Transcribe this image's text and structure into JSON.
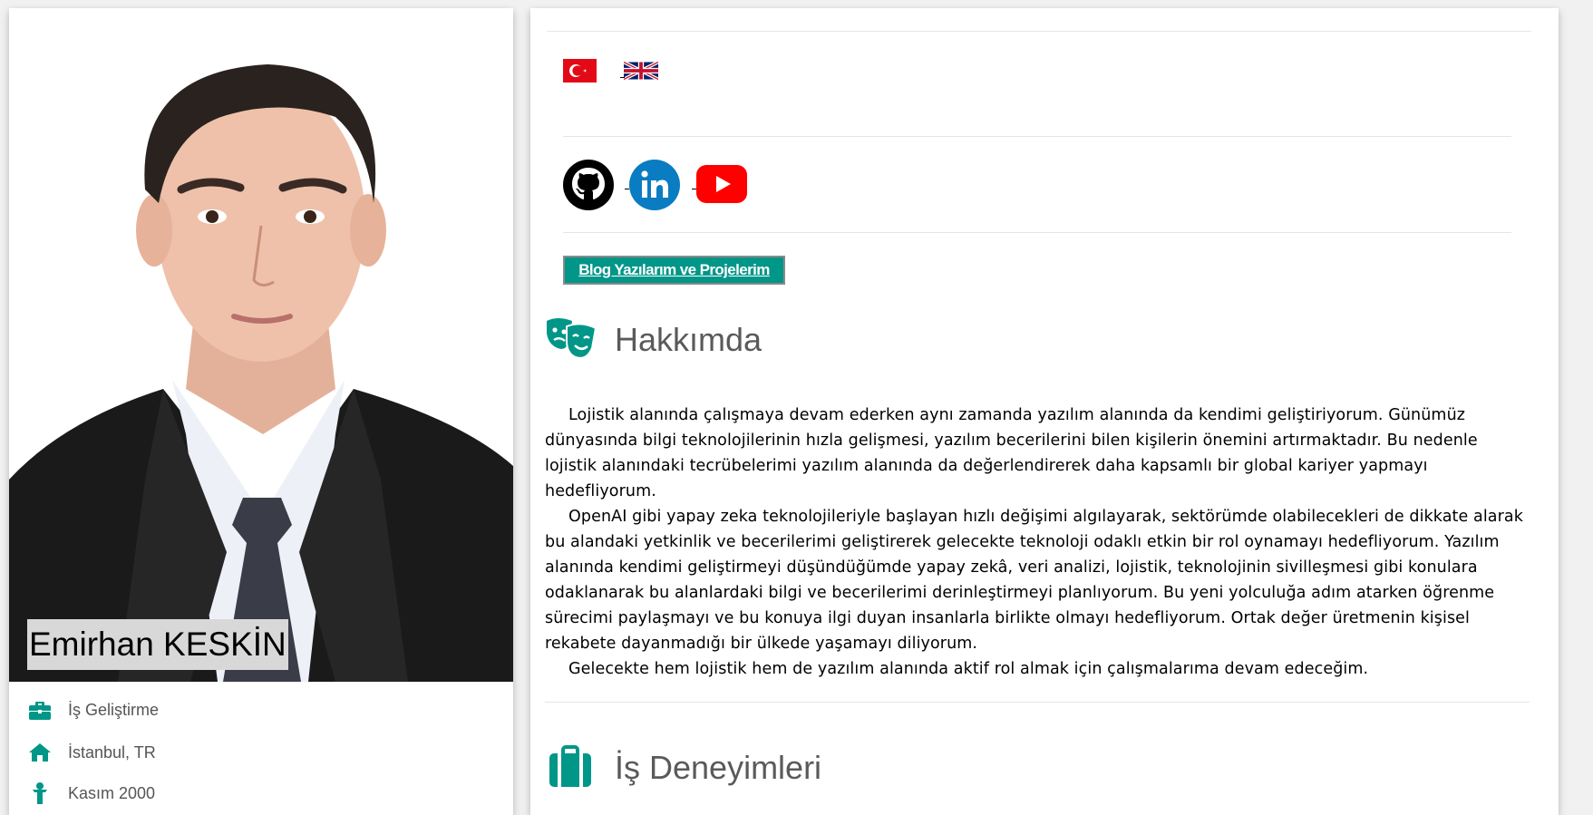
{
  "profile": {
    "name": "Emirhan KESKİN",
    "info": [
      {
        "icon": "briefcase-icon",
        "text": "İş Geliştirme"
      },
      {
        "icon": "home-icon",
        "text": "İstanbul, TR"
      },
      {
        "icon": "person-icon",
        "text": "Kasım 2000"
      }
    ]
  },
  "languages": [
    {
      "icon": "turkey-flag-icon",
      "label": "TR"
    },
    {
      "icon": "uk-flag-icon",
      "label": "EN"
    }
  ],
  "social": [
    {
      "icon": "github-icon"
    },
    {
      "icon": "linkedin-icon"
    },
    {
      "icon": "youtube-icon"
    }
  ],
  "blog_button": "Blog Yazılarım ve Projelerim",
  "about": {
    "icon": "theater-masks-icon",
    "title": "Hakkımda",
    "paragraphs": [
      "Lojistik alanında çalışmaya devam ederken aynı zamanda yazılım alanında da kendimi geliştiriyorum. Günümüz dünyasında bilgi teknolojilerinin hızla gelişmesi, yazılım becerilerini bilen kişilerin önemini artırmaktadır. Bu nedenle lojistik alanındaki tecrübelerimi yazılım alanında da değerlendirerek daha kapsamlı bir global kariyer yapmayı hedefliyorum.",
      "OpenAI gibi yapay zeka teknolojileriyle başlayan hızlı değişimi algılayarak, sektörümde olabilecekleri de dikkate alarak bu alandaki yetkinlik ve becerilerimi geliştirerek gelecekte teknoloji odaklı etkin bir rol oynamayı hedefliyorum. Yazılım alanında kendimi geliştirmeyi düşündüğümde yapay zekâ, veri analizi, lojistik, teknolojinin sivilleşmesi gibi konulara odaklanarak bu alanlardaki bilgi ve becerilerimi derinleştirmeyi planlıyorum. Bu yeni yolculuğa adım atarken öğrenme sürecimi paylaşmayı ve bu konuya ilgi duyan insanlarla birlikte olmayı hedefliyorum. Ortak değer üretmenin kişisel rekabete dayanmadığı bir ülkede yaşamayı diliyorum.",
      "Gelecekte hem lojistik hem de yazılım alanında aktif rol almak için çalışmalarıma devam edeceğim."
    ]
  },
  "experience": {
    "icon": "clipboard-icon",
    "title": "İş Deneyimleri"
  },
  "colors": {
    "accent": "#009688",
    "page_bg": "#f1f1f1",
    "name_tag_bg": "#d8d8d8"
  }
}
